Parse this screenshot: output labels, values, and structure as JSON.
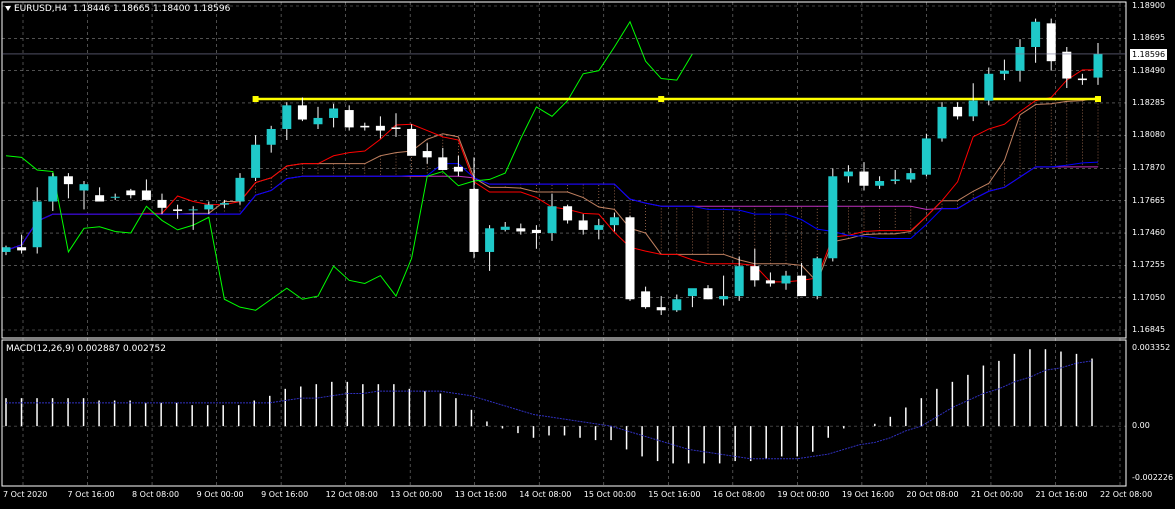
{
  "header": {
    "symbol": "EURUSD,H4",
    "ohlc": "1.18446 1.18665 1.18400 1.18596"
  },
  "macd": {
    "label": "MACD(12,26,9) 0.002887 0.002752",
    "axis": [
      "0.003352",
      "0.00",
      "-0.002226"
    ]
  },
  "price_axis": [
    "1.18900",
    "1.18695",
    "1.18490",
    "1.18285",
    "1.18080",
    "1.17870",
    "1.17665",
    "1.17460",
    "1.17255",
    "1.17050",
    "1.16845"
  ],
  "current_price": "1.18596",
  "time_axis": [
    "7 Oct 2020",
    "7 Oct 16:00",
    "8 Oct 08:00",
    "9 Oct 00:00",
    "9 Oct 16:00",
    "12 Oct 08:00",
    "13 Oct 00:00",
    "13 Oct 16:00",
    "14 Oct 08:00",
    "15 Oct 00:00",
    "15 Oct 16:00",
    "16 Oct 08:00",
    "19 Oct 00:00",
    "19 Oct 16:00",
    "20 Oct 08:00",
    "21 Oct 00:00",
    "21 Oct 16:00",
    "22 Oct 08:00"
  ],
  "colors": {
    "background": "#000000",
    "grid": "#808080",
    "bull": "#1fc9c9",
    "bear": "#ffffff",
    "support_line": "#ffff00",
    "tenkan": "#ff0000",
    "kijun": "#0000ff",
    "chikou": "#00ff00",
    "senkou_b": "#c030c0",
    "cloud": "#c08060",
    "macd_signal": "#3030c0"
  },
  "chart_data": {
    "type": "candlestick",
    "symbol": "EURUSD",
    "timeframe": "H4",
    "ylim": [
      1.16845,
      1.189
    ],
    "support_level": 1.1831,
    "candles": [
      [
        1.1734,
        1.1738,
        1.1732,
        1.1737
      ],
      [
        1.1737,
        1.1745,
        1.1733,
        1.1735
      ],
      [
        1.1737,
        1.1775,
        1.1733,
        1.1766
      ],
      [
        1.1766,
        1.1784,
        1.176,
        1.1782
      ],
      [
        1.1782,
        1.1784,
        1.1768,
        1.1777
      ],
      [
        1.1773,
        1.1779,
        1.1761,
        1.1777
      ],
      [
        1.177,
        1.1775,
        1.1766,
        1.1766
      ],
      [
        1.1769,
        1.1771,
        1.1767,
        1.1769
      ],
      [
        1.1773,
        1.1774,
        1.1768,
        1.177
      ],
      [
        1.1773,
        1.178,
        1.177,
        1.1767
      ],
      [
        1.1767,
        1.1771,
        1.1758,
        1.1762
      ],
      [
        1.1761,
        1.1764,
        1.1755,
        1.176
      ],
      [
        1.1761,
        1.1763,
        1.1748,
        1.1761
      ],
      [
        1.1761,
        1.1766,
        1.1758,
        1.1764
      ],
      [
        1.1764,
        1.1767,
        1.1762,
        1.1765
      ],
      [
        1.1766,
        1.1784,
        1.1764,
        1.1781
      ],
      [
        1.1781,
        1.1808,
        1.1779,
        1.1802
      ],
      [
        1.1802,
        1.1814,
        1.1797,
        1.1812
      ],
      [
        1.1812,
        1.1829,
        1.1805,
        1.1827
      ],
      [
        1.1827,
        1.1832,
        1.1817,
        1.1818
      ],
      [
        1.1815,
        1.1826,
        1.1812,
        1.1819
      ],
      [
        1.1819,
        1.1828,
        1.1813,
        1.1825
      ],
      [
        1.1824,
        1.1827,
        1.1811,
        1.1813
      ],
      [
        1.1814,
        1.1816,
        1.1811,
        1.1813
      ],
      [
        1.1814,
        1.182,
        1.1806,
        1.1811
      ],
      [
        1.1813,
        1.1822,
        1.1807,
        1.1812
      ],
      [
        1.1812,
        1.1815,
        1.1798,
        1.1795
      ],
      [
        1.1798,
        1.1803,
        1.179,
        1.1794
      ],
      [
        1.1794,
        1.18,
        1.1786,
        1.1786
      ],
      [
        1.1788,
        1.1795,
        1.1782,
        1.1785
      ],
      [
        1.1774,
        1.1794,
        1.173,
        1.1734
      ],
      [
        1.1734,
        1.1751,
        1.1722,
        1.1749
      ],
      [
        1.1748,
        1.1753,
        1.1747,
        1.175
      ],
      [
        1.1749,
        1.1752,
        1.1745,
        1.1747
      ],
      [
        1.1748,
        1.1751,
        1.1736,
        1.1746
      ],
      [
        1.1746,
        1.1771,
        1.1741,
        1.1763
      ],
      [
        1.1763,
        1.1764,
        1.1752,
        1.1754
      ],
      [
        1.1754,
        1.1758,
        1.1745,
        1.1748
      ],
      [
        1.1748,
        1.1755,
        1.1742,
        1.1751
      ],
      [
        1.1751,
        1.1759,
        1.1747,
        1.1756
      ],
      [
        1.1756,
        1.1757,
        1.1703,
        1.1704
      ],
      [
        1.1709,
        1.1712,
        1.1698,
        1.1699
      ],
      [
        1.1699,
        1.1706,
        1.1694,
        1.1697
      ],
      [
        1.1697,
        1.1707,
        1.1696,
        1.1704
      ],
      [
        1.1706,
        1.171,
        1.1699,
        1.1711
      ],
      [
        1.1711,
        1.1713,
        1.1704,
        1.1704
      ],
      [
        1.1704,
        1.1719,
        1.17,
        1.1706
      ],
      [
        1.1706,
        1.1731,
        1.1703,
        1.1725
      ],
      [
        1.1725,
        1.1736,
        1.1712,
        1.1716
      ],
      [
        1.1716,
        1.1721,
        1.1712,
        1.1714
      ],
      [
        1.1714,
        1.1722,
        1.171,
        1.1719
      ],
      [
        1.1719,
        1.1727,
        1.1706,
        1.1706
      ],
      [
        1.1706,
        1.1731,
        1.1704,
        1.173
      ],
      [
        1.173,
        1.1787,
        1.1728,
        1.1782
      ],
      [
        1.1782,
        1.1789,
        1.1778,
        1.1785
      ],
      [
        1.1785,
        1.1791,
        1.1773,
        1.1776
      ],
      [
        1.1776,
        1.1782,
        1.1774,
        1.1779
      ],
      [
        1.1779,
        1.1786,
        1.1777,
        1.178
      ],
      [
        1.178,
        1.1787,
        1.1778,
        1.1784
      ],
      [
        1.1783,
        1.1809,
        1.1782,
        1.1806
      ],
      [
        1.1806,
        1.1829,
        1.1804,
        1.1826
      ],
      [
        1.1826,
        1.1829,
        1.1818,
        1.182
      ],
      [
        1.182,
        1.1841,
        1.1817,
        1.183
      ],
      [
        1.183,
        1.1851,
        1.1827,
        1.1847
      ],
      [
        1.1847,
        1.1856,
        1.1843,
        1.1849
      ],
      [
        1.1849,
        1.1869,
        1.1842,
        1.1864
      ],
      [
        1.1864,
        1.1882,
        1.1854,
        1.188
      ],
      [
        1.1879,
        1.1882,
        1.1849,
        1.1855
      ],
      [
        1.1861,
        1.1864,
        1.1838,
        1.1844
      ],
      [
        1.1844,
        1.1847,
        1.184,
        1.1843
      ],
      [
        1.18446,
        1.18665,
        1.184,
        1.18596
      ]
    ],
    "macd_hist": [
      0.0012,
      0.0012,
      0.0012,
      0.0012,
      0.0012,
      0.0012,
      0.0011,
      0.0011,
      0.0011,
      0.001,
      0.001,
      0.001,
      0.0009,
      0.0009,
      0.0009,
      0.0009,
      0.0011,
      0.0013,
      0.0016,
      0.0017,
      0.0018,
      0.0019,
      0.0019,
      0.0018,
      0.0018,
      0.0018,
      0.0016,
      0.0015,
      0.0014,
      0.0012,
      0.0007,
      0.0002,
      -0.0001,
      -0.0003,
      -0.0005,
      -0.0004,
      -0.0004,
      -0.0005,
      -0.0006,
      -0.0006,
      -0.001,
      -0.0013,
      -0.0015,
      -0.0016,
      -0.0016,
      -0.0016,
      -0.0016,
      -0.0015,
      -0.0015,
      -0.0014,
      -0.0013,
      -0.0013,
      -0.0011,
      -0.0005,
      -0.0001,
      0.0,
      0.0001,
      0.0004,
      0.0008,
      0.0012,
      0.0016,
      0.0019,
      0.0022,
      0.0026,
      0.0028,
      0.0031,
      0.0033,
      0.0033,
      0.0032,
      0.0031,
      0.0029
    ],
    "macd_signal": [
      0.001,
      0.001,
      0.001,
      0.001,
      0.001,
      0.001,
      0.001,
      0.001,
      0.001,
      0.001,
      0.001,
      0.001,
      0.001,
      0.001,
      0.001,
      0.001,
      0.001,
      0.001,
      0.0011,
      0.0012,
      0.0012,
      0.0013,
      0.0014,
      0.0014,
      0.0015,
      0.0015,
      0.0015,
      0.0015,
      0.0015,
      0.0014,
      0.0013,
      0.0011,
      0.0009,
      0.0007,
      0.0005,
      0.0004,
      0.0003,
      0.0002,
      0.0001,
      0.0,
      -0.0002,
      -0.0004,
      -0.0006,
      -0.0008,
      -0.001,
      -0.0011,
      -0.0012,
      -0.0013,
      -0.0014,
      -0.0014,
      -0.0014,
      -0.0014,
      -0.0013,
      -0.0012,
      -0.001,
      -0.0008,
      -0.0007,
      -0.0005,
      -0.0002,
      0.0,
      0.0004,
      0.0008,
      0.0011,
      0.0014,
      0.0016,
      0.0019,
      0.0021,
      0.0024,
      0.0025,
      0.0027,
      0.0028
    ]
  }
}
